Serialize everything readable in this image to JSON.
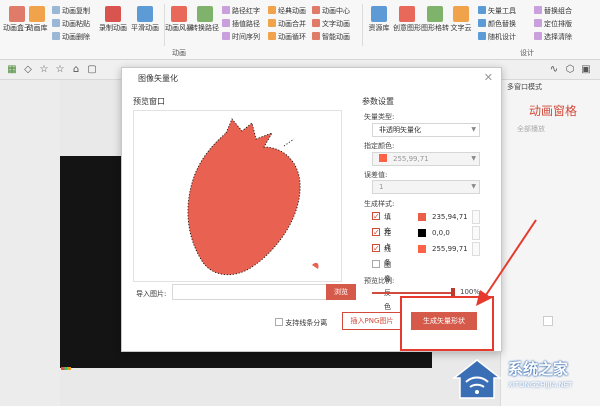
{
  "ribbon": {
    "left_buttons": [
      "动画盒子",
      "动画库"
    ],
    "anim_group": [
      "动画复制",
      "动画粘贴",
      "动画删除"
    ],
    "big_buttons": [
      "录制动画",
      "平滑动画"
    ],
    "path_group": [
      "动画风暴",
      "路径组",
      "转换路径"
    ],
    "mid_group_a": [
      "路径红字",
      "插值路径",
      "时间序列"
    ],
    "mid_group_b": [
      "经典动画",
      "动画合并",
      "动画循环"
    ],
    "mid_group_c": [
      "动画中心",
      "文字动画",
      "智能动画"
    ],
    "group_label_anim": "动画",
    "res_buttons": [
      "资源库",
      "创意图形",
      "图形格转",
      "文字云"
    ],
    "design_group_a": [
      "矢量工具",
      "颜色替换",
      "随机设计"
    ],
    "design_group_b": [
      "替换组合",
      "定位排版",
      "选择清除"
    ],
    "group_label_design": "设计"
  },
  "right_panel": {
    "tab": "多窗口模式",
    "title": "动画窗格",
    "sub": "全部播放"
  },
  "dialog": {
    "title": "图像矢量化",
    "preview_title": "预览窗口",
    "params_title": "参数设置",
    "vector_type_label": "矢量类型:",
    "vector_type_value": "非透明矢量化",
    "color_label": "指定颜色:",
    "color_value": "255,99,71",
    "tolerance_label": "误差值:",
    "tolerance_value": "1",
    "style_label": "生成样式:",
    "styles": [
      {
        "name": "填充",
        "value": "235,94,71",
        "color": "#eb5e47",
        "checked": true
      },
      {
        "name": "控点",
        "value": "0,0,0",
        "color": "#000000",
        "checked": true
      },
      {
        "name": "线条",
        "value": "255,99,71",
        "color": "#ff6347",
        "checked": true
      }
    ],
    "invert_label": "图像反色",
    "scale_label": "预览比例:",
    "scale_value": "100%",
    "scale_fraction": 1.0,
    "import_label": "导入图片:",
    "browse": "浏览",
    "split_label": "支持线条分离",
    "insert_btn": "插入PNG图片",
    "generate_btn": "生成矢量形状"
  },
  "watermark": {
    "text": "系统之家",
    "url": "XITONGZHIJIA.NET"
  },
  "colors": {
    "accent": "#d65a4a",
    "strawberry": "#e96150",
    "highlight": "#e53a2d"
  }
}
